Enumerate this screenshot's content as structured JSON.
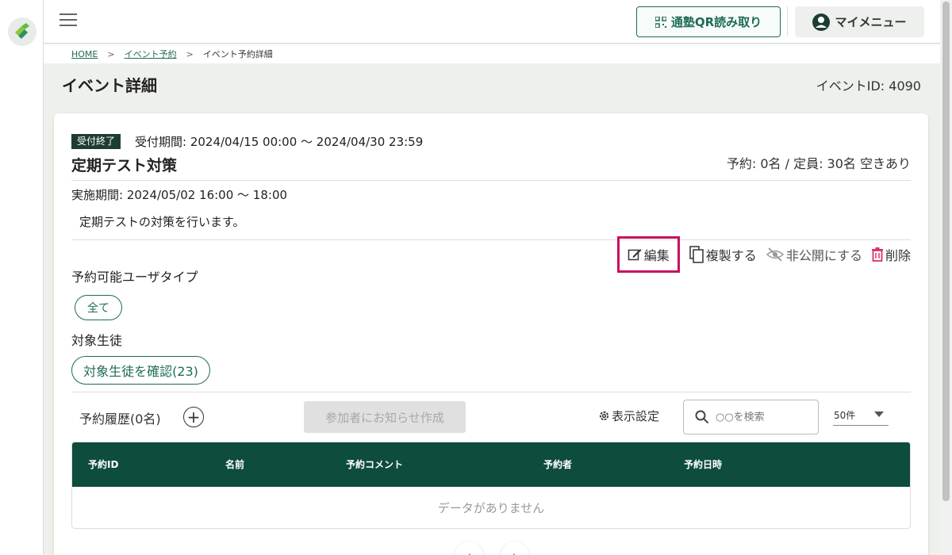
{
  "header": {
    "qr_button_label": "通塾QR読み取り",
    "mymenu_button_label": "マイメニュー"
  },
  "breadcrumb": {
    "home": "HOME",
    "separator": ">",
    "event_reservation": "イベント予約",
    "current": "イベント予約詳細"
  },
  "page": {
    "title": "イベント詳細",
    "event_id": "イベントID: 4090"
  },
  "event": {
    "status_badge": "受付終了",
    "reception_period": "受付期間: 2024/04/15 00:00 ～ 2024/04/30 23:59",
    "name": "定期テスト対策",
    "capacity": "予約: 0名 / 定員: 30名 空きあり",
    "schedule": "実施期間: 2024/05/02 16:00 ～ 18:00",
    "description": "定期テストの対策を行います。"
  },
  "actions": {
    "edit": "編集",
    "duplicate": "複製する",
    "unpublish": "非公開にする",
    "delete": "削除"
  },
  "user_type": {
    "label": "予約可能ユーザタイプ",
    "value": "全て"
  },
  "target_students": {
    "label": "対象生徒",
    "button": "対象生徒を確認(23)"
  },
  "history": {
    "label": "予約履歴(0名)",
    "notify_button": "参加者にお知らせ作成",
    "display_settings": "表示設定",
    "search_placeholder": "○○を検索",
    "per_page": "50件"
  },
  "table": {
    "columns": [
      "予約ID",
      "名前",
      "予約コメント",
      "予約者",
      "予約日時"
    ],
    "empty_message": "データがありません"
  },
  "colors": {
    "brand_green": "#1f6b58",
    "table_header": "#0e4c3d",
    "highlight": "#c8105f"
  }
}
